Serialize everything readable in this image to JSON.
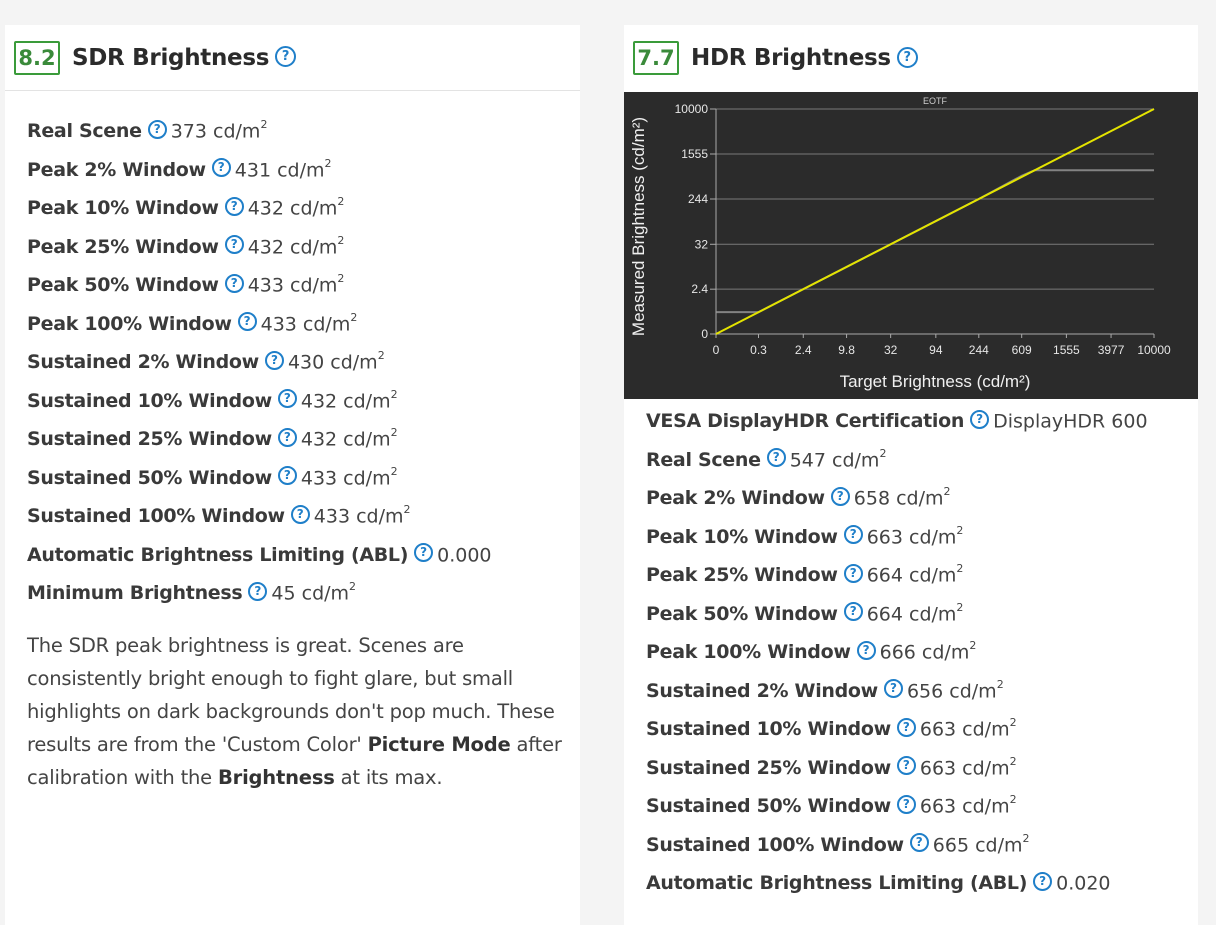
{
  "sdr": {
    "score": "8.2",
    "title": "SDR Brightness",
    "help_glyph": "?",
    "rows": [
      {
        "label": "Real Scene",
        "value": "373 cd/m",
        "sup": "2"
      },
      {
        "label": "Peak 2% Window",
        "value": "431 cd/m",
        "sup": "2"
      },
      {
        "label": "Peak 10% Window",
        "value": "432 cd/m",
        "sup": "2"
      },
      {
        "label": "Peak 25% Window",
        "value": "432 cd/m",
        "sup": "2"
      },
      {
        "label": "Peak 50% Window",
        "value": "433 cd/m",
        "sup": "2"
      },
      {
        "label": "Peak 100% Window",
        "value": "433 cd/m",
        "sup": "2"
      },
      {
        "label": "Sustained 2% Window",
        "value": "430 cd/m",
        "sup": "2"
      },
      {
        "label": "Sustained 10% Window",
        "value": "432 cd/m",
        "sup": "2"
      },
      {
        "label": "Sustained 25% Window",
        "value": "432 cd/m",
        "sup": "2"
      },
      {
        "label": "Sustained 50% Window",
        "value": "433 cd/m",
        "sup": "2"
      },
      {
        "label": "Sustained 100% Window",
        "value": "433 cd/m",
        "sup": "2"
      },
      {
        "label": "Automatic Brightness Limiting (ABL)",
        "value": "0.000",
        "sup": ""
      },
      {
        "label": "Minimum Brightness",
        "value": "45 cd/m",
        "sup": "2"
      }
    ],
    "desc": {
      "t1": "The SDR peak brightness is great. Scenes are consistently bright enough to fight glare, but small highlights on dark backgrounds don't pop much. These results are from the 'Custom Color' ",
      "b1": "Picture Mode",
      "t2": " after calibration with the ",
      "b2": "Brightness",
      "t3": " at its max."
    }
  },
  "hdr": {
    "score": "7.7",
    "title": "HDR Brightness",
    "help_glyph": "?",
    "rows": [
      {
        "label": "VESA DisplayHDR Certification",
        "value": "DisplayHDR 600",
        "sup": ""
      },
      {
        "label": "Real Scene",
        "value": "547 cd/m",
        "sup": "2"
      },
      {
        "label": "Peak 2% Window",
        "value": "658 cd/m",
        "sup": "2"
      },
      {
        "label": "Peak 10% Window",
        "value": "663 cd/m",
        "sup": "2"
      },
      {
        "label": "Peak 25% Window",
        "value": "664 cd/m",
        "sup": "2"
      },
      {
        "label": "Peak 50% Window",
        "value": "664 cd/m",
        "sup": "2"
      },
      {
        "label": "Peak 100% Window",
        "value": "666 cd/m",
        "sup": "2"
      },
      {
        "label": "Sustained 2% Window",
        "value": "656 cd/m",
        "sup": "2"
      },
      {
        "label": "Sustained 10% Window",
        "value": "663 cd/m",
        "sup": "2"
      },
      {
        "label": "Sustained 25% Window",
        "value": "663 cd/m",
        "sup": "2"
      },
      {
        "label": "Sustained 50% Window",
        "value": "663 cd/m",
        "sup": "2"
      },
      {
        "label": "Sustained 100% Window",
        "value": "665 cd/m",
        "sup": "2"
      },
      {
        "label": "Automatic Brightness Limiting (ABL)",
        "value": "0.020",
        "sup": ""
      }
    ]
  },
  "colors": {
    "score_green": "#3a9b3a",
    "help_blue": "#1f7fc9",
    "chart_bg": "#2b2b2b",
    "series_measured": "#e4e400",
    "series_target": "#9a9a9a"
  },
  "chart_data": {
    "type": "line",
    "title": "EOTF",
    "xlabel": "Target Brightness (cd/m²)",
    "ylabel": "Measured Brightness (cd/m²)",
    "x_ticks": [
      "0",
      "0.3",
      "2.4",
      "9.8",
      "32",
      "94",
      "244",
      "609",
      "1555",
      "3977",
      "10000"
    ],
    "y_ticks": [
      "0",
      "2.4",
      "32",
      "244",
      "1555",
      "10000"
    ],
    "x_scale": "pq",
    "y_scale": "pq",
    "grid": true,
    "series": [
      {
        "x": [
          0,
          10000
        ],
        "y": [
          0,
          10000
        ]
      },
      {
        "x": [
          0,
          0.3,
          2.4,
          9.8,
          32,
          94,
          244,
          609,
          800,
          10000
        ],
        "y": [
          0.3,
          0.3,
          2.4,
          9.8,
          32,
          94,
          244,
          640,
          800,
          800
        ]
      }
    ]
  }
}
